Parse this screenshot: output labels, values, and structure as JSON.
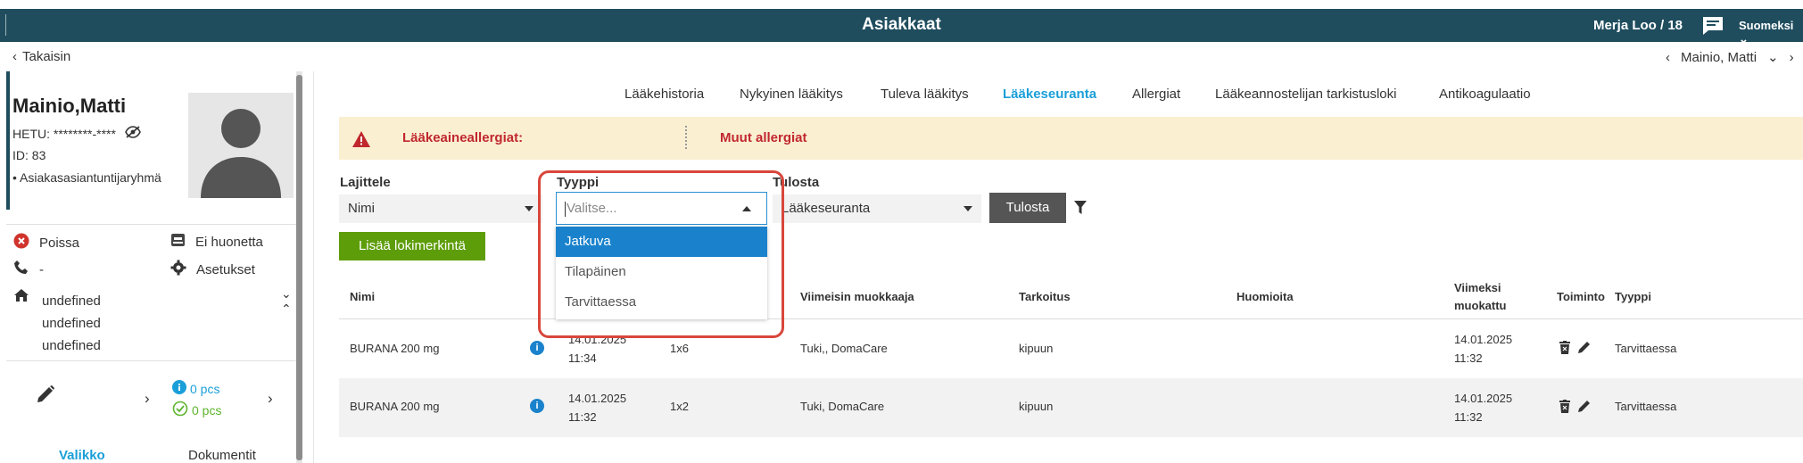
{
  "header": {
    "title": "Asiakkaat",
    "user": "Merja Loo / 18",
    "language": "Suomeksi"
  },
  "nav": {
    "back_label": "Takaisin",
    "patient_switch": "Mainio, Matti"
  },
  "patient": {
    "name": "Mainio,Matti",
    "hetu": "HETU: ********-****",
    "id": "ID: 83",
    "group": "• Asiakasasiantuntijaryhmä",
    "status": "Poissa",
    "room": "Ei huonetta",
    "phone": "-",
    "settings": "Asetukset",
    "address": [
      "undefined",
      "undefined",
      "undefined"
    ],
    "count_info": "0 pcs",
    "count_done": "0 pcs",
    "tab_menu": "Valikko",
    "tab_documents": "Dokumentit"
  },
  "tabs": [
    {
      "label": "Lääkehistoria",
      "active": false
    },
    {
      "label": "Nykyinen lääkitys",
      "active": false
    },
    {
      "label": "Tuleva lääkitys",
      "active": false
    },
    {
      "label": "Lääkeseuranta",
      "active": true
    },
    {
      "label": "Allergiat",
      "active": false
    },
    {
      "label": "Lääkeannostelijan tarkistusloki",
      "active": false
    },
    {
      "label": "Antikoagulaatio",
      "active": false
    }
  ],
  "allergy": {
    "drug_allergies": "Lääkeaineallergiat:",
    "other_allergies": "Muut allergiat"
  },
  "filters": {
    "sort_label": "Lajittele",
    "sort_value": "Nimi",
    "type_label": "Tyyppi",
    "type_placeholder": "Valitse...",
    "print_label": "Tulosta",
    "print_value": "Lääkeseuranta",
    "print_button": "Tulosta",
    "type_options": [
      "Jatkuva",
      "Tilapäinen",
      "Tarvittaessa"
    ],
    "type_highlighted": "Jatkuva"
  },
  "add_button": "Lisää lokimerkintä",
  "table": {
    "headers": {
      "name": "Nimi",
      "last_editor": "Viimeisin muokkaaja",
      "purpose": "Tarkoitus",
      "notes": "Huomioita",
      "modified_1": "Viimeksi",
      "modified_2": "muokattu",
      "action": "Toiminto",
      "type": "Tyyppi"
    },
    "rows": [
      {
        "name": "BURANA 200 mg",
        "date": "14.01.2025",
        "time": "11:34",
        "dose": "1x6",
        "editor": "Tuki,, DomaCare",
        "purpose": "kipuun",
        "notes": "",
        "mod_date": "14.01.2025",
        "mod_time": "11:32",
        "type": "Tarvittaessa"
      },
      {
        "name": "BURANA 200 mg",
        "date": "14.01.2025",
        "time": "11:32",
        "dose": "1x2",
        "editor": "Tuki, DomaCare",
        "purpose": "kipuun",
        "notes": "",
        "mod_date": "14.01.2025",
        "mod_time": "11:32",
        "type": "Tarvittaessa"
      }
    ]
  },
  "colors": {
    "header_bg": "#1f4d5e",
    "accent_blue": "#1a9fd8",
    "alert_red": "#c0282e",
    "allergy_bg": "#fbefd2",
    "add_green": "#5e9d0a",
    "highlight_red": "#d9463b"
  }
}
